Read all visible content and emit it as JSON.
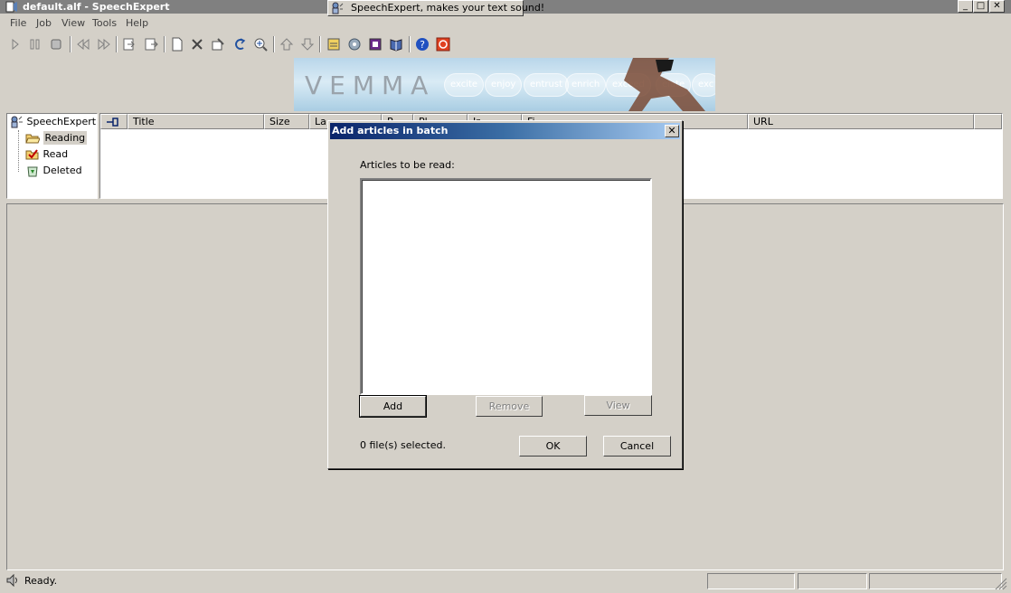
{
  "window": {
    "title": "default.alf - SpeechExpert",
    "minimize_icon": "minimize-icon",
    "maximize_icon": "maximize-icon",
    "close_icon": "close-icon"
  },
  "tooltip": {
    "text": "SpeechExpert, makes your text sound!"
  },
  "menu": {
    "items": [
      "File",
      "Job",
      "View",
      "Tools",
      "Help"
    ]
  },
  "toolbar": {
    "buttons": [
      "play-icon",
      "pause-icon",
      "stop-icon",
      "rewind-icon",
      "fast-forward-icon",
      "import-icon",
      "export-icon",
      "new-document-icon",
      "delete-icon",
      "properties-icon",
      "refresh-icon",
      "zoom-icon",
      "move-up-icon",
      "move-down-icon",
      "schedule-icon",
      "settings-icon",
      "voice-icon",
      "book-icon",
      "help-icon",
      "exit-icon"
    ]
  },
  "banner": {
    "logo_text": "VEMMA",
    "slogans": [
      "excite",
      "enjoy",
      "entrust",
      "enrich",
      "exceed",
      "elate",
      "exc"
    ]
  },
  "tree": {
    "root": "SpeechExpert",
    "items": [
      {
        "label": "Reading",
        "icon": "folder-open-icon",
        "selected": true
      },
      {
        "label": "Read",
        "icon": "folder-checked-icon",
        "selected": false
      },
      {
        "label": "Deleted",
        "icon": "recycle-bin-icon",
        "selected": false
      }
    ]
  },
  "list": {
    "columns": [
      "",
      "Title",
      "Size",
      "La",
      "P",
      "Pl",
      "Ir",
      "Fi",
      "URL"
    ]
  },
  "status": {
    "text": "Ready."
  },
  "dialog": {
    "title": "Add articles in batch",
    "articles_label": "Articles to be read:",
    "add_label": "Add",
    "remove_label": "Remove",
    "view_label": "View",
    "files_selected": "0 file(s) selected.",
    "ok_label": "OK",
    "cancel_label": "Cancel"
  }
}
